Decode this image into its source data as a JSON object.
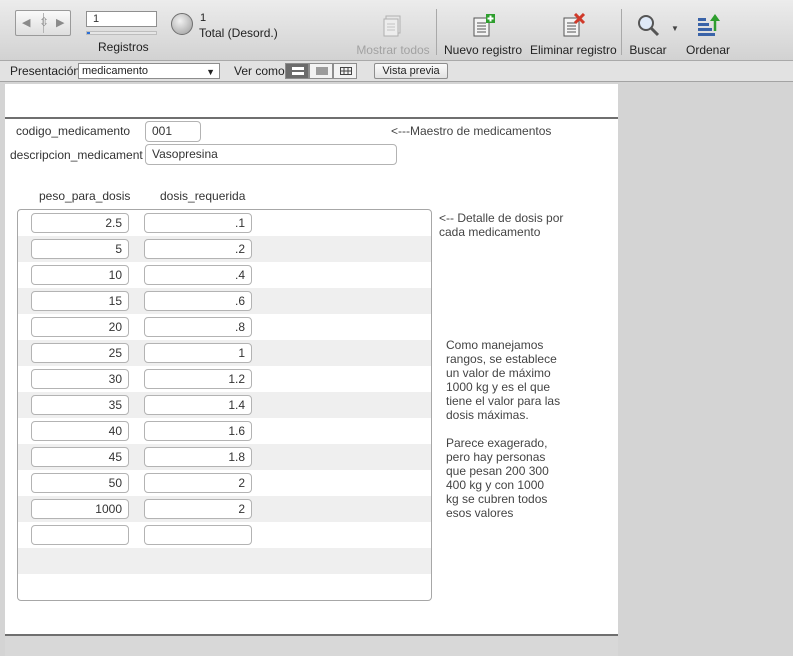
{
  "toolbar": {
    "record_number": "1",
    "record_progress": 1.0,
    "records_label": "Registros",
    "found_count": "1",
    "found_total_label": "Total (Desord.)",
    "show_all_label": "Mostrar todos",
    "new_record_label": "Nuevo registro",
    "delete_record_label": "Eliminar registro",
    "find_label": "Buscar",
    "sort_label": "Ordenar"
  },
  "layout_bar": {
    "layout_label": "Presentación:",
    "layout_value": "medicamento",
    "view_as_label": "Ver como:",
    "preview_label": "Vista previa",
    "view_modes": [
      "form",
      "list",
      "table"
    ],
    "active_view": "form"
  },
  "form": {
    "codigo_label": "codigo_medicamento",
    "codigo_value": "001",
    "descripcion_label": "descripcion_medicament",
    "descripcion_value": "Vasopresina",
    "master_note": "<---Maestro de medicamentos",
    "col_peso_label": "peso_para_dosis",
    "col_dosis_label": "dosis_requerida",
    "detail_note_1": "<-- Detalle de dosis por",
    "detail_note_2": "cada medicamento",
    "range_note": [
      "Como manejamos",
      "rangos, se establece",
      "un valor de máximo",
      "1000 kg y es el que",
      "tiene el valor para las",
      "dosis máximas.",
      "",
      "Parece exagerado,",
      "pero hay personas",
      "que pesan 200 300",
      "400 kg y con 1000",
      "kg se cubren todos",
      "esos valores"
    ]
  },
  "portal_rows": [
    {
      "peso": "2.5",
      "dosis": ".1"
    },
    {
      "peso": "5",
      "dosis": ".2"
    },
    {
      "peso": "10",
      "dosis": ".4"
    },
    {
      "peso": "15",
      "dosis": ".6"
    },
    {
      "peso": "20",
      "dosis": ".8"
    },
    {
      "peso": "25",
      "dosis": "1"
    },
    {
      "peso": "30",
      "dosis": "1.2"
    },
    {
      "peso": "35",
      "dosis": "1.4"
    },
    {
      "peso": "40",
      "dosis": "1.6"
    },
    {
      "peso": "45",
      "dosis": "1.8"
    },
    {
      "peso": "50",
      "dosis": "2"
    },
    {
      "peso": "1000",
      "dosis": "2"
    },
    {
      "peso": "",
      "dosis": ""
    }
  ],
  "colors": {
    "accent": "#2c6fd6",
    "add_green": "#2e9e2e",
    "delete_red": "#d03a2a"
  }
}
